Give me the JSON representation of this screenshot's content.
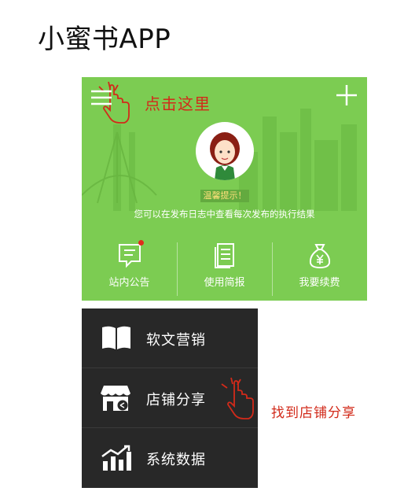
{
  "page_title": "小蜜书APP",
  "card": {
    "hint": "点击这里",
    "tip_badge": "温馨提示！",
    "tip_text": "您可以在发布日志中查看每次发布的执行结果",
    "actions": [
      {
        "label": "站内公告",
        "icon": "announcement-icon",
        "has_dot": true
      },
      {
        "label": "使用简报",
        "icon": "report-icon"
      },
      {
        "label": "我要续费",
        "icon": "money-bag-icon"
      }
    ]
  },
  "menu": {
    "items": [
      {
        "label": "软文营销",
        "icon": "book-icon"
      },
      {
        "label": "店铺分享",
        "icon": "store-share-icon"
      },
      {
        "label": "系统数据",
        "icon": "chart-icon"
      }
    ]
  },
  "annotation2": "找到店铺分享",
  "colors": {
    "card_green": "#7ccc52",
    "menu_dark": "#282828",
    "hint_red": "#d22a1a"
  }
}
